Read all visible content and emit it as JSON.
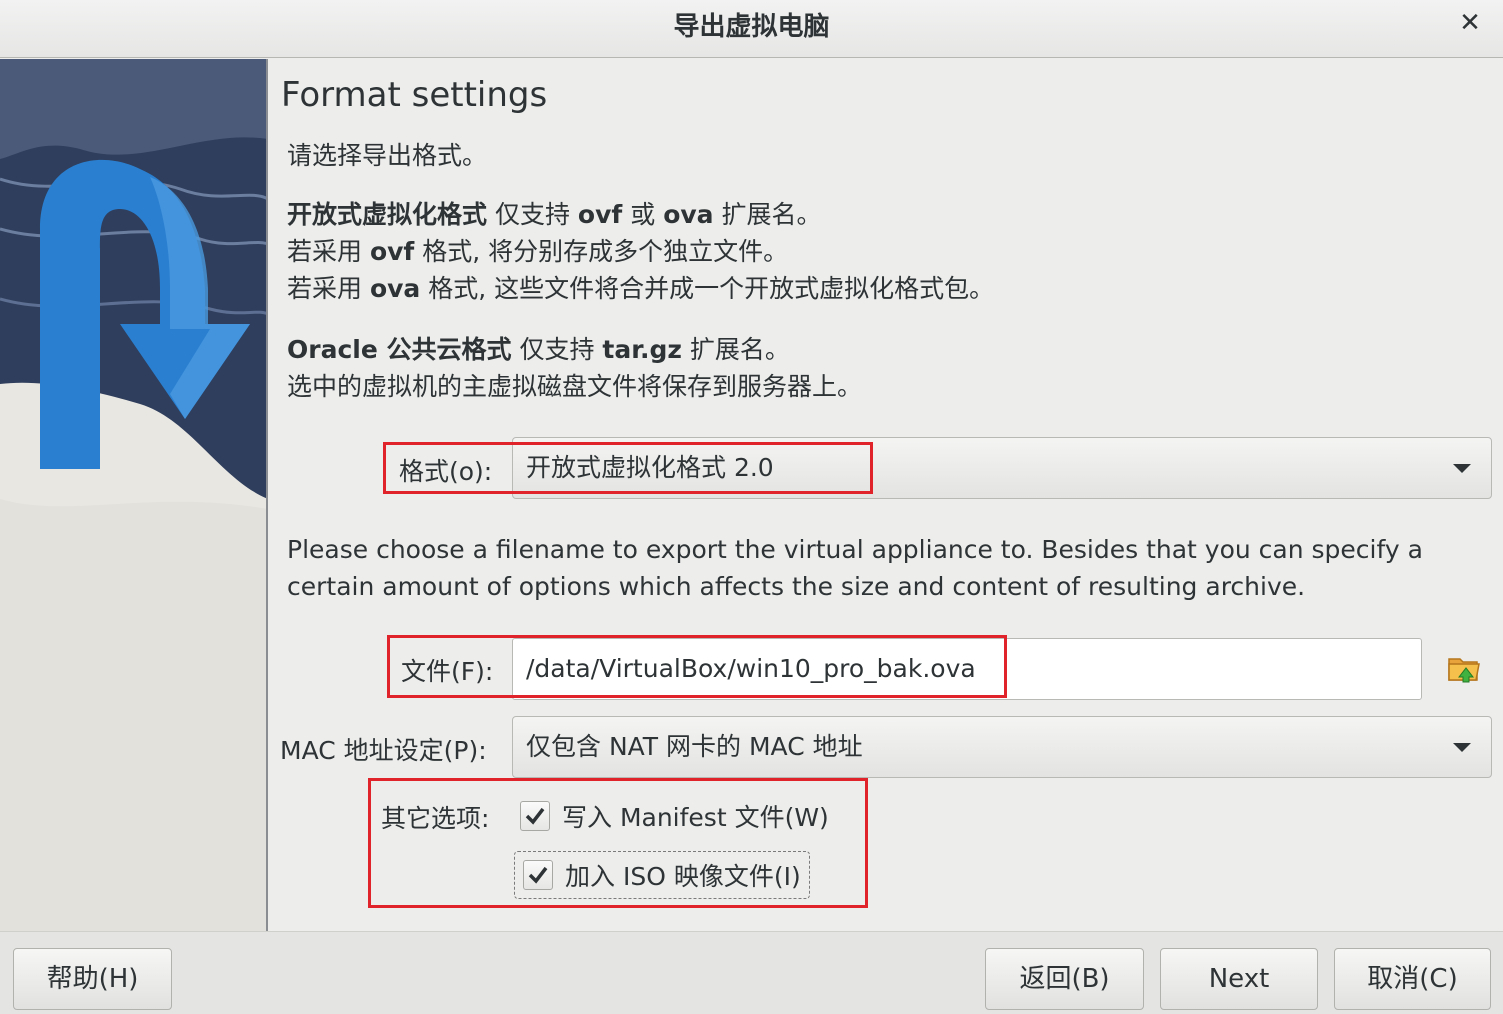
{
  "window": {
    "title": "导出虚拟电脑",
    "close_icon": "close-icon"
  },
  "page": {
    "heading": "Format settings",
    "intro": "请选择导出格式。",
    "ovf_desc": {
      "bold": "开放式虚拟化格式",
      "line1_a": " 仅支持 ",
      "line1_ovf": "ovf",
      "line1_b": " 或 ",
      "line1_ova": "ova",
      "line1_c": " 扩展名。",
      "line2_a": "若采用 ",
      "line2_ovf": "ovf",
      "line2_b": " 格式, 将分别存成多个独立文件。",
      "line3_a": "若采用 ",
      "line3_ova": "ova",
      "line3_b": " 格式, 这些文件将合并成一个开放式虚拟化格式包。"
    },
    "oracle_desc": {
      "bold": "Oracle 公共云格式",
      "line1_a": " 仅支持 ",
      "line1_ext": "tar.gz",
      "line1_b": " 扩展名。",
      "line2": "选中的虚拟机的主虚拟磁盘文件将保存到服务器上。"
    },
    "format": {
      "label": "格式(o):",
      "value": "开放式虚拟化格式 2.0"
    },
    "filename_desc": "Please choose a filename to export the virtual appliance to. Besides that you can specify a certain amount of options which affects the size and content of resulting archive.",
    "file": {
      "label": "文件(F):",
      "value": "/data/VirtualBox/win10_pro_bak.ova",
      "button_icon": "folder-icon"
    },
    "mac": {
      "label": "MAC 地址设定(P):",
      "value": "仅包含 NAT 网卡的 MAC 地址"
    },
    "options": {
      "label": "其它选项:",
      "manifest": {
        "label": "写入 Manifest 文件(W)",
        "checked": true
      },
      "iso": {
        "label": "加入 ISO 映像文件(I)",
        "checked": true
      }
    }
  },
  "footer": {
    "help": "帮助(H)",
    "back": "返回(B)",
    "next": "Next",
    "cancel": "取消(C)"
  },
  "colors": {
    "highlight": "#e0232b",
    "banner_arrow": "#2a7fd0"
  }
}
